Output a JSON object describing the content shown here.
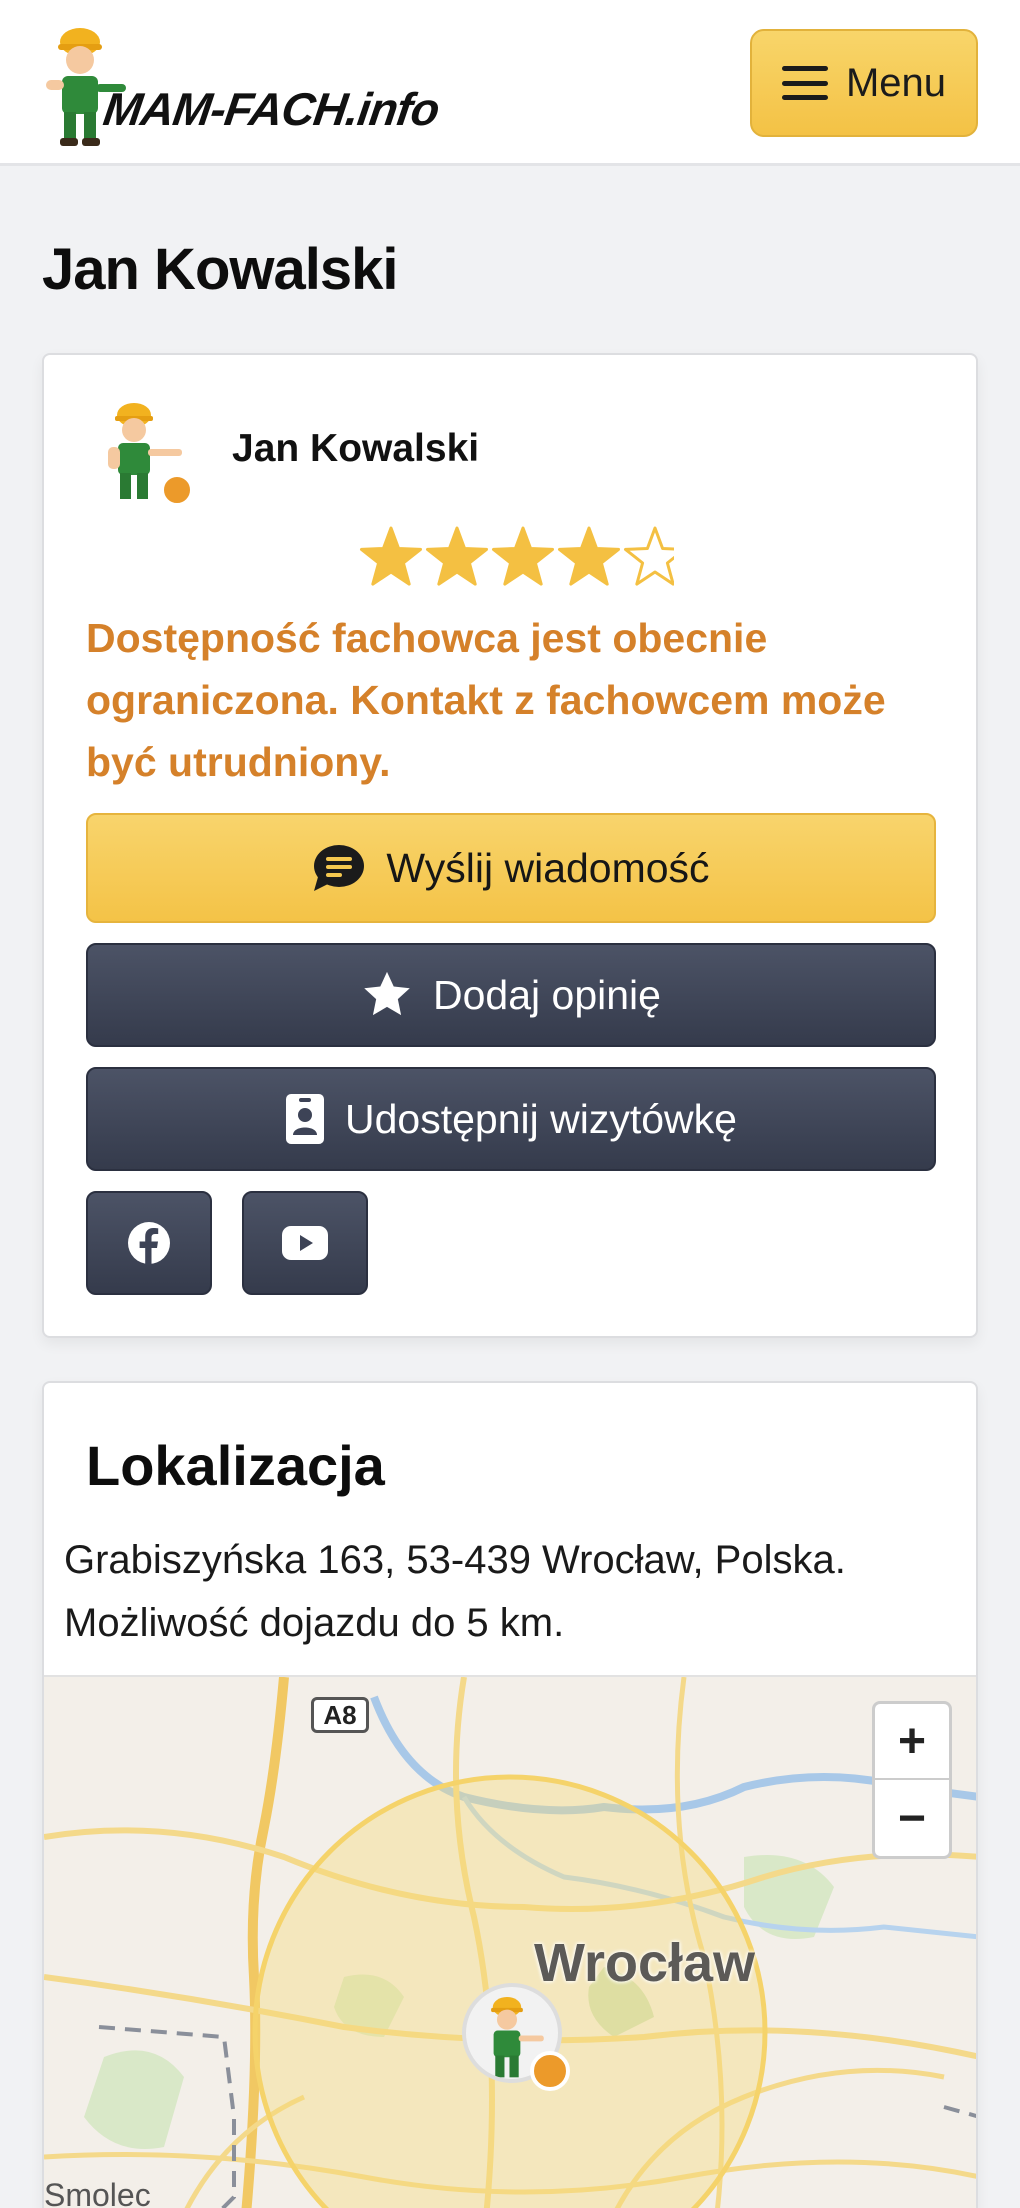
{
  "header": {
    "logo_text": "MAM-FACH.info",
    "menu_label": "Menu"
  },
  "page": {
    "title": "Jan Kowalski"
  },
  "profile": {
    "name": "Jan Kowalski",
    "rating": 4,
    "rating_max": 5,
    "status_color": "#ec9a2a",
    "availability_notice": "Dostępność fachowca jest obecnie ograniczona. Kontakt z fachowcem może być utrudniony.",
    "buttons": {
      "message": "Wyślij wiadomość",
      "review": "Dodaj opinię",
      "share": "Udostępnij wizytówkę"
    },
    "social": [
      "facebook-icon",
      "youtube-icon"
    ]
  },
  "location": {
    "title": "Lokalizacja",
    "address": "Grabiszyńska 163, 53-439 Wrocław, Polska. Możliwość dojazdu do 5 km.",
    "map": {
      "city": "Wrocław",
      "town": "Smolec",
      "road": "A8",
      "zoom_in": "+",
      "zoom_out": "−"
    }
  },
  "colors": {
    "accent": "#f4c347",
    "dark_button": "#3d4356",
    "warning_text": "#d5812a"
  }
}
